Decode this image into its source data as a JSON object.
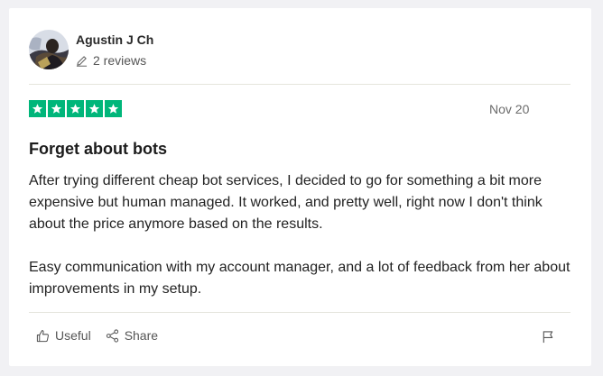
{
  "reviewer": {
    "name": "Agustin J Ch",
    "review_count": "2 reviews"
  },
  "review": {
    "rating": 5,
    "rating_max": 5,
    "date": "Nov 20",
    "title": "Forget about bots",
    "paragraphs": [
      "After trying different cheap bot services, I decided to go for something a bit more expensive but human managed. It worked, and pretty well, right now I don't think about the price anymore based on the results.",
      "Easy communication with my account manager, and a lot of feedback from her about improvements in my setup."
    ]
  },
  "actions": {
    "useful_label": "Useful",
    "share_label": "Share"
  },
  "icons": {
    "pencil": "pencil-icon",
    "thumbs_up": "thumbs-up-icon",
    "share": "share-icon",
    "flag": "flag-icon",
    "star": "star-icon"
  },
  "colors": {
    "star_green": "#00b67a",
    "background": "#f1f1f4",
    "card": "#ffffff",
    "divider": "#e5e5dd"
  }
}
